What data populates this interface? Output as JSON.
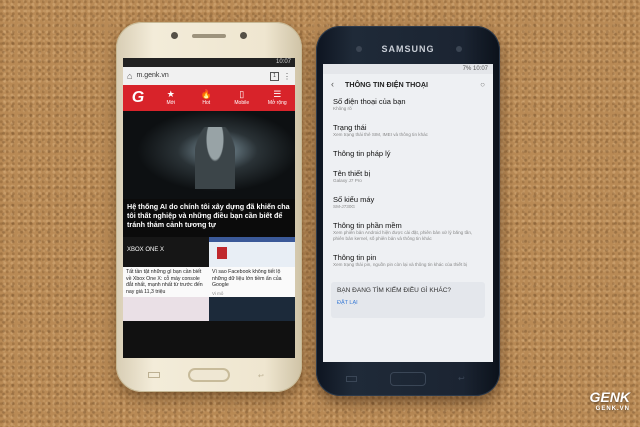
{
  "left_phone": {
    "status_time": "10:07",
    "url": "m.genk.vn",
    "tab_count": "1",
    "nav": [
      {
        "icon": "★",
        "label": "Mới"
      },
      {
        "icon": "🔥",
        "label": "Hot"
      },
      {
        "icon": "▯",
        "label": "Mobile"
      },
      {
        "icon": "☰",
        "label": "Mở rộng"
      }
    ],
    "headline": "Hệ thống AI do chính tôi xây dựng đã khiến cha tôi thất nghiệp và những điều bạn cần biết để tránh thảm cảnh tương tự",
    "card1": {
      "image_text": "XBOX ONE X",
      "text": "Tất tần tật những gì bạn cần biết về Xbox One X: cỗ máy console đắt nhất, mạnh nhất từ trước đến nay giá 11,3 triệu",
      "meta": "10 giờ trước"
    },
    "card2": {
      "text": "Vì sao Facebook không tiết lộ những dữ liệu lớn tiềm ẩn của Google",
      "meta": "Vi mô"
    }
  },
  "right_phone": {
    "brand": "SAMSUNG",
    "status_time": "10:07",
    "status_battery": "7%",
    "title": "THÔNG TIN ĐIỆN THOẠI",
    "settings": [
      {
        "title": "Số điện thoại của bạn",
        "sub": "Không rõ"
      },
      {
        "title": "Trạng thái",
        "sub": "Xem trạng thái thẻ SIM, IMEI và thông tin khác"
      },
      {
        "title": "Thông tin pháp lý",
        "sub": ""
      },
      {
        "title": "Tên thiết bị",
        "sub": "Galaxy J7 Pro"
      },
      {
        "title": "Số kiểu máy",
        "sub": "SM-J730G"
      },
      {
        "title": "Thông tin phần mềm",
        "sub": "Xem phiên bản Android hiện được cài đặt, phiên bản xử lý băng tần, phiên bản kernel, số phiên bản và thông tin khác"
      },
      {
        "title": "Thông tin pin",
        "sub": "Xem trạng thái pin, nguồn pin còn lại và thông tin khác của thiết bị"
      }
    ],
    "suggest_title": "BẠN ĐANG TÌM KIẾM ĐIỀU GÌ KHÁC?",
    "suggest_link": "ĐẶT LẠI"
  },
  "watermark": {
    "brand": "GENK",
    "sub": "GENK.VN"
  }
}
